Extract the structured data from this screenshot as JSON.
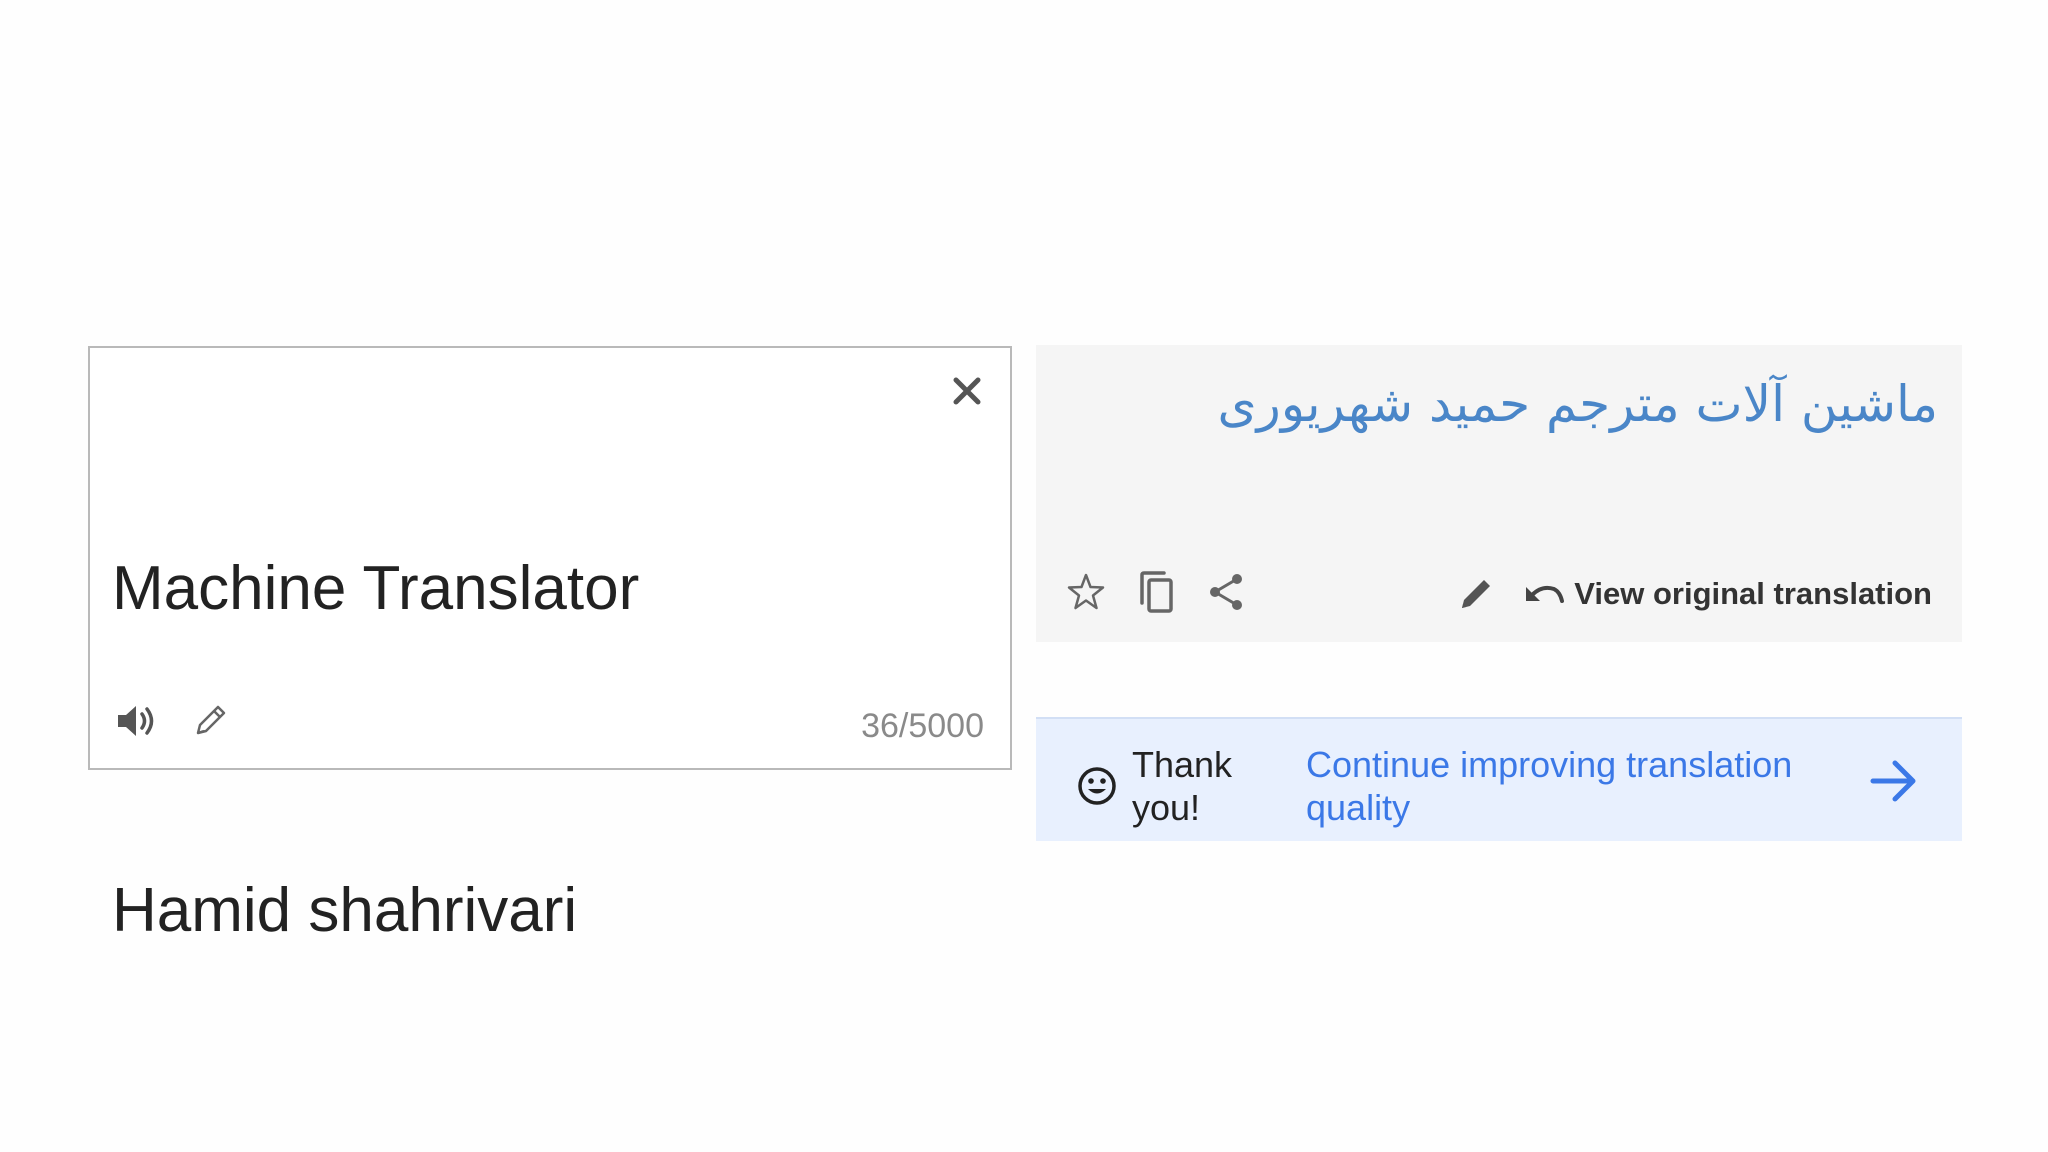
{
  "source": {
    "line1": "Machine Translator",
    "line2": "Hamid shahrivari",
    "char_count": "36/5000",
    "icons": {
      "clear": "close-icon",
      "listen": "speaker-icon",
      "handwrite": "pencil-icon"
    }
  },
  "target": {
    "translation": "ماشین آلات مترجم حمید شهریوری",
    "view_original_label": "View original translation",
    "icons": {
      "star": "star-icon",
      "copy": "copy-icon",
      "share": "share-icon",
      "edit": "pencil-icon",
      "undo": "undo-icon"
    }
  },
  "feedback": {
    "thanks_text": "Thank you!",
    "continue_text": "Continue improving translation quality",
    "icons": {
      "smiley": "smiley-icon",
      "arrow": "arrow-right-icon"
    }
  },
  "colors": {
    "translation_text": "#4a86c8",
    "link": "#3b78e7",
    "feedback_bg": "#e8f0fe",
    "target_bg": "#f5f5f5"
  }
}
